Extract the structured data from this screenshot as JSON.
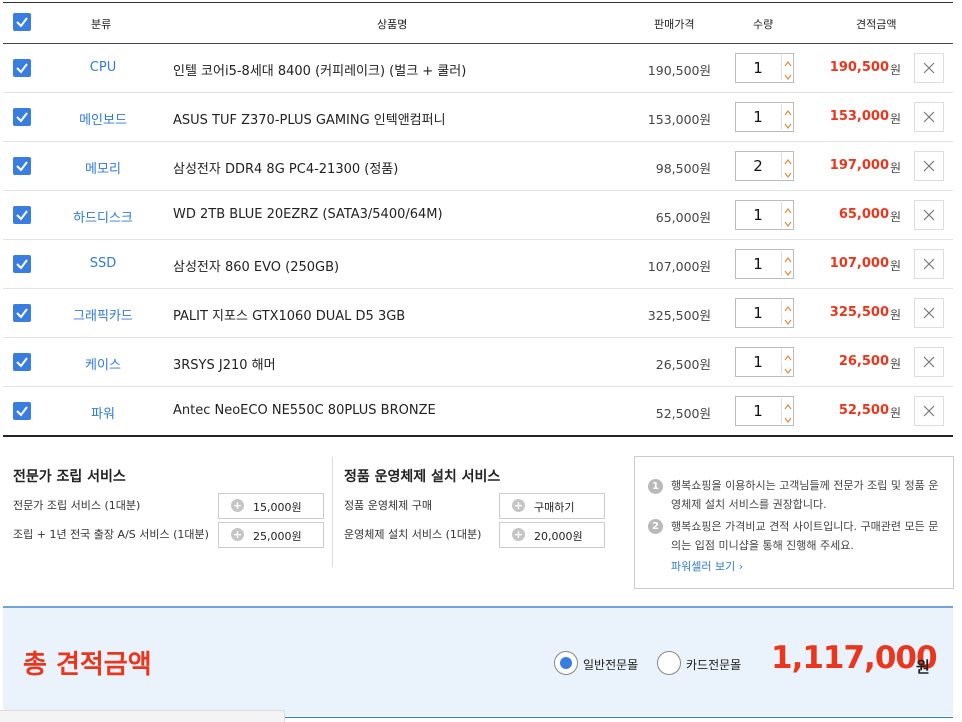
{
  "header": {
    "category": "분류",
    "product": "상품명",
    "price": "판매가격",
    "quantity": "수량",
    "estimate": "견적금액"
  },
  "items": [
    {
      "category": "CPU",
      "name": "인텔 코어i5-8세대 8400 (커피레이크) (벌크 + 쿨러)",
      "price": "190,500원",
      "qty": "1",
      "estimate": "190,500",
      "won": "원"
    },
    {
      "category": "메인보드",
      "name": "ASUS TUF Z370-PLUS GAMING 인텍앤컴퍼니",
      "price": "153,000원",
      "qty": "1",
      "estimate": "153,000",
      "won": "원"
    },
    {
      "category": "메모리",
      "name": "삼성전자 DDR4 8G PC4-21300 (정품)",
      "price": "98,500원",
      "qty": "2",
      "estimate": "197,000",
      "won": "원"
    },
    {
      "category": "하드디스크",
      "name": "WD 2TB BLUE 20EZRZ (SATA3/5400/64M)",
      "price": "65,000원",
      "qty": "1",
      "estimate": "65,000",
      "won": "원"
    },
    {
      "category": "SSD",
      "name": "삼성전자 860 EVO (250GB)",
      "price": "107,000원",
      "qty": "1",
      "estimate": "107,000",
      "won": "원"
    },
    {
      "category": "그래픽카드",
      "name": "PALIT 지포스 GTX1060 DUAL D5 3GB",
      "price": "325,500원",
      "qty": "1",
      "estimate": "325,500",
      "won": "원"
    },
    {
      "category": "케이스",
      "name": "3RSYS J210 해머",
      "price": "26,500원",
      "qty": "1",
      "estimate": "26,500",
      "won": "원"
    },
    {
      "category": "파워",
      "name": "Antec NeoECO NE550C 80PLUS BRONZE",
      "price": "52,500원",
      "qty": "1",
      "estimate": "52,500",
      "won": "원"
    }
  ],
  "assembly": {
    "title": "전문가 조립 서비스",
    "rows": [
      {
        "label": "전문가 조립 서비스 (1대분)",
        "button": "15,000원"
      },
      {
        "label": "조립 + 1년 전국 출장 A/S 서비스 (1대분)",
        "button": "25,000원"
      }
    ]
  },
  "os": {
    "title": "정품 운영체제 설치 서비스",
    "rows": [
      {
        "label": "정품 운영체제 구매",
        "button": "구매하기"
      },
      {
        "label": "운영체제 설치 서비스 (1대분)",
        "button": "20,000원"
      }
    ]
  },
  "notice": {
    "items": [
      {
        "num": "1",
        "text": "행복쇼핑을 이용하시는 고객님들께 전문가 조립 및 정품 운영체제 설치 서비스를 권장합니다."
      },
      {
        "num": "2",
        "text": "행복쇼핑은 가격비교 견적 사이트입니다. 구매관련 모든 문의는 입점 미니샵을 통해 진행해 주세요."
      }
    ],
    "link": "파워셀러 보기 ›"
  },
  "total": {
    "label": "총 견적금액",
    "option1": "일반전문몰",
    "option2": "카드전문몰",
    "amount": "1,117,000",
    "won": "원"
  },
  "colors": {
    "accent_blue": "#3a7de0",
    "category_blue": "#2f7bd9",
    "price_red": "#e9361d",
    "total_bg": "#eaf2fb"
  }
}
